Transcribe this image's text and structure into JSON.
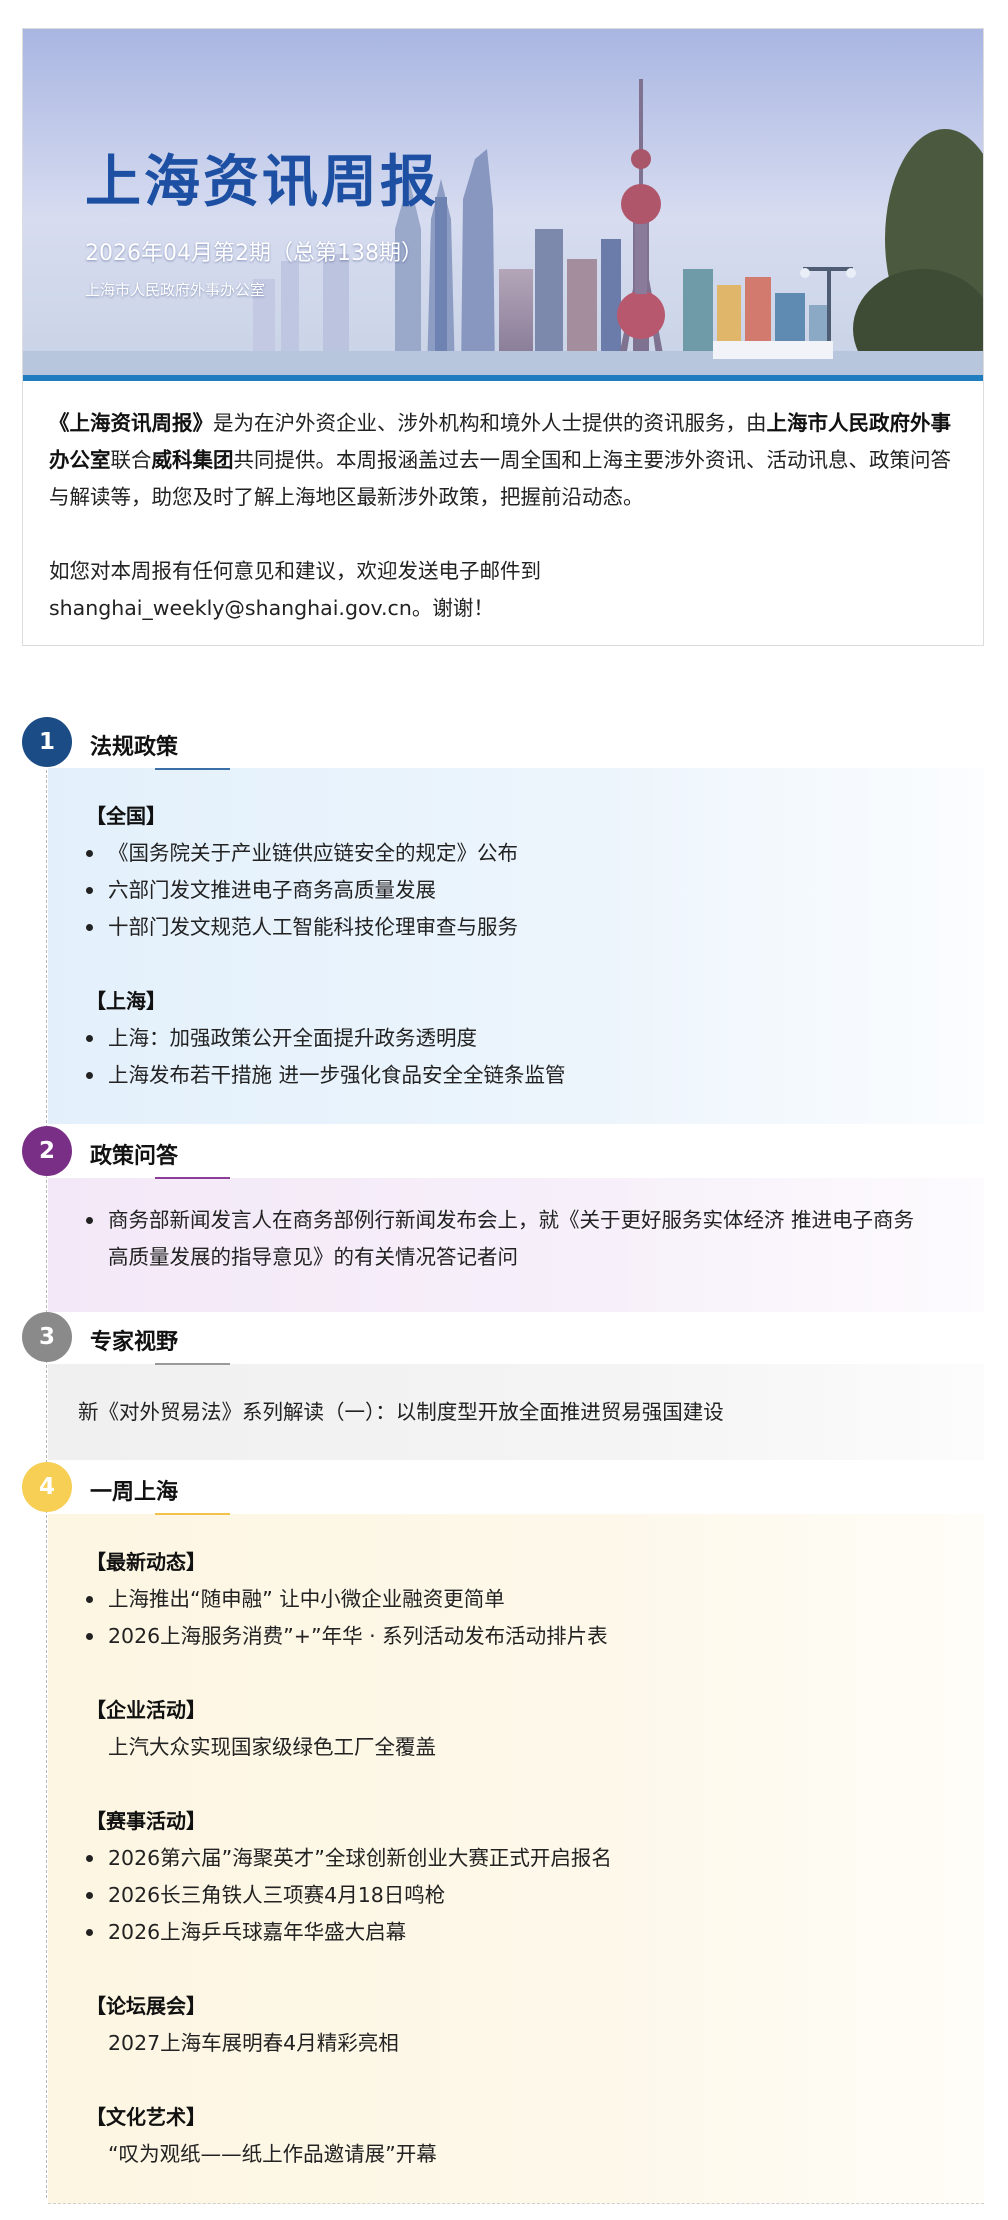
{
  "banner": {
    "title": "上海资讯周报",
    "issue": "2026年04月第2期（总第138期）",
    "office": "上海市人民政府外事办公室"
  },
  "intro": {
    "p1": [
      {
        "t": "《上海资讯周报》",
        "b": true
      },
      {
        "t": "是为在沪外资企业、涉外机构和境外人士提供的资讯服务，由",
        "b": false
      },
      {
        "t": "上海市人民政府外事办公室",
        "b": true
      },
      {
        "t": "联合",
        "b": false
      },
      {
        "t": "威科集团",
        "b": true
      },
      {
        "t": "共同提供。本周报涵盖过去一周全国和上海主要涉外资讯、活动讯息、政策问答与解读等，助您及时了解上海地区最新涉外政策，把握前沿动态。",
        "b": false
      }
    ],
    "p2_line1": "如您对本周报有任何意见和建议，欢迎发送电子邮件到",
    "p2_line2": "shanghai_weekly@shanghai.gov.cn。谢谢！"
  },
  "colors": {
    "sec1": "#1c4c85",
    "sec2": "#7a2f86",
    "sec3": "#8a8a8a",
    "sec4": "#f7cf55",
    "banner_bar": "#1f7dc0",
    "title": "#1d4fa3"
  },
  "sections": [
    {
      "num": "1",
      "title": "法规政策",
      "groups": [
        {
          "label": "【全国】",
          "items": [
            "《国务院关于产业链供应链安全的规定》公布",
            "六部门发文推进电子商务高质量发展",
            "十部门发文规范人工智能科技伦理审查与服务"
          ]
        },
        {
          "label": "【上海】",
          "items": [
            "上海：加强政策公开全面提升政务透明度",
            "上海发布若干措施 进一步强化食品安全全链条监管"
          ]
        }
      ]
    },
    {
      "num": "2",
      "title": "政策问答",
      "item_line1": "商务部新闻发言人在商务部例行新闻发布会上，就《关于更好服务实体经济 推进电子商务",
      "item_line2": "高质量发展的指导意见》的有关情况答记者问"
    },
    {
      "num": "3",
      "title": "专家视野",
      "text": "新《对外贸易法》系列解读（一）：以制度型开放全面推进贸易强国建设"
    },
    {
      "num": "4",
      "title": "一周上海",
      "groups": [
        {
          "label": "【最新动态】",
          "items": [
            "上海推出“随申融” 让中小微企业融资更简单",
            "2026上海服务消费”+”年华 · 系列活动发布活动排片表"
          ]
        },
        {
          "label": "【企业活动】",
          "plain": "上汽大众实现国家级绿色工厂全覆盖"
        },
        {
          "label": "【赛事活动】",
          "items": [
            "2026第六届”海聚英才”全球创新创业大赛正式开启报名",
            "2026长三角铁人三项赛4月18日鸣枪",
            "2026上海乒乓球嘉年华盛大启幕"
          ]
        },
        {
          "label": "【论坛展会】",
          "plain": "2027上海车展明春4月精彩亮相"
        },
        {
          "label": "【文化艺术】",
          "plain": "“叹为观纸——纸上作品邀请展”开幕"
        }
      ]
    }
  ]
}
